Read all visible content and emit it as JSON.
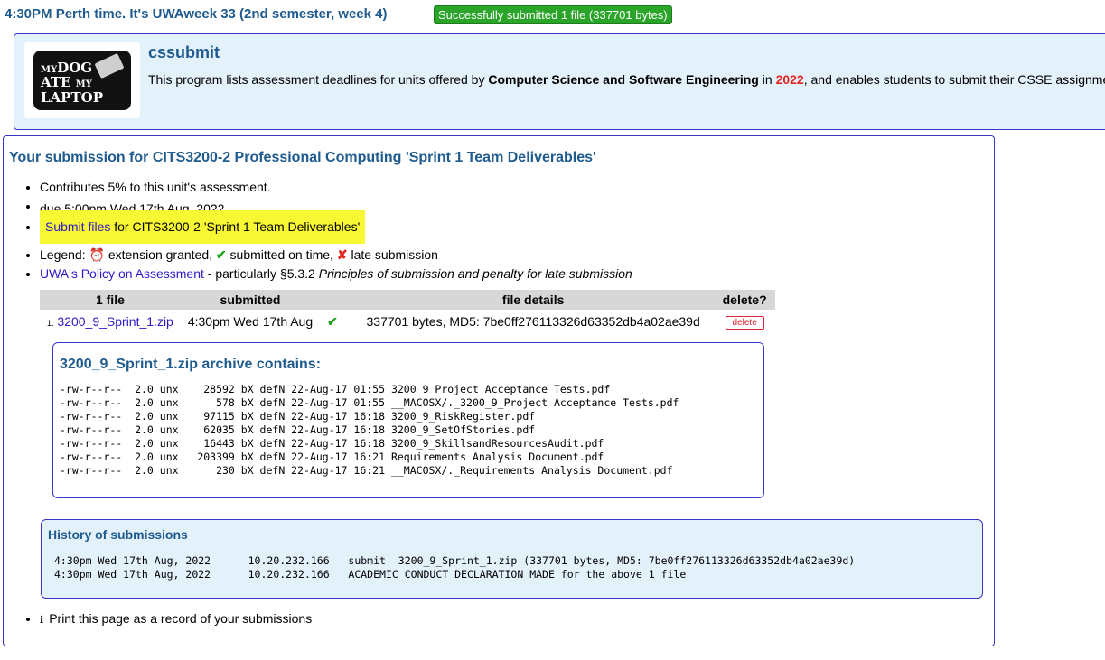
{
  "status": {
    "time_line": "4:30PM Perth time.  It's UWAweek 33 (2nd semester, week 4)",
    "success_badge": "Successfully submitted 1 file (337701 bytes)"
  },
  "header": {
    "logo_line1_a": "MY",
    "logo_line1_b": "DOG",
    "logo_line2_a": "ATE",
    "logo_line2_b": "MY",
    "logo_line3": "LAPTOP",
    "title": "cssubmit",
    "desc_a": "This program lists assessment deadlines for units offered by ",
    "desc_b": "Computer Science and Software Engineering",
    "desc_c": " in ",
    "desc_year": "2022",
    "desc_d": ", and enables students to submit their CSSE assignme"
  },
  "submission": {
    "title": "Your submission for CITS3200-2 Professional Computing 'Sprint 1 Team Deliverables'",
    "contributes": "Contributes 5% to this unit's assessment.",
    "due": "due 5:00pm Wed 17th Aug, 2022",
    "submit_link": "Submit files",
    "submit_rest": " for CITS3200-2 'Sprint 1 Team Deliverables'",
    "legend_label": "Legend: ",
    "legend_ext": " extension granted, ",
    "legend_ontime": " submitted on time, ",
    "legend_late": " late submission",
    "policy_link": "UWA's Policy on Assessment",
    "policy_mid": " - particularly §5.3.2 ",
    "policy_italic": "Principles of submission and penalty for late submission",
    "icons": {
      "alarm": "alarm-clock-icon",
      "tick": "check-icon",
      "cross": "cross-icon",
      "info": "info-icon"
    },
    "colors": {
      "tick": "#1fa31f",
      "cross": "#e3261f",
      "highlight": "#f7f733"
    }
  },
  "files_table": {
    "headers": [
      "1 file",
      "submitted",
      "",
      "file details",
      "delete?"
    ],
    "rows": [
      {
        "num": "1.",
        "name": "3200_9_Sprint_1.zip",
        "submitted": "4:30pm Wed 17th Aug",
        "details": "337701 bytes,  MD5: 7be0ff276113326d63352db4a02ae39d",
        "delete_label": "delete"
      }
    ]
  },
  "archive": {
    "title": "3200_9_Sprint_1.zip archive contains:",
    "listing": "-rw-r--r--  2.0 unx    28592 bX defN 22-Aug-17 01:55 3200_9_Project Acceptance Tests.pdf\n-rw-r--r--  2.0 unx      578 bX defN 22-Aug-17 01:55 __MACOSX/._3200_9_Project Acceptance Tests.pdf\n-rw-r--r--  2.0 unx    97115 bX defN 22-Aug-17 16:18 3200_9_RiskRegister.pdf\n-rw-r--r--  2.0 unx    62035 bX defN 22-Aug-17 16:18 3200_9_SetOfStories.pdf\n-rw-r--r--  2.0 unx    16443 bX defN 22-Aug-17 16:18 3200_9_SkillsandResourcesAudit.pdf\n-rw-r--r--  2.0 unx   203399 bX defN 22-Aug-17 16:21 Requirements Analysis Document.pdf\n-rw-r--r--  2.0 unx      230 bX defN 22-Aug-17 16:21 __MACOSX/._Requirements Analysis Document.pdf"
  },
  "history": {
    "title": "History of submissions",
    "entries": "4:30pm Wed 17th Aug, 2022      10.20.232.166   submit  3200_9_Sprint_1.zip (337701 bytes, MD5: 7be0ff276113326d63352db4a02ae39d)\n4:30pm Wed 17th Aug, 2022      10.20.232.166   ACADEMIC CONDUCT DECLARATION MADE for the above 1 file"
  },
  "print_note": "Print this page as a record of your submissions"
}
